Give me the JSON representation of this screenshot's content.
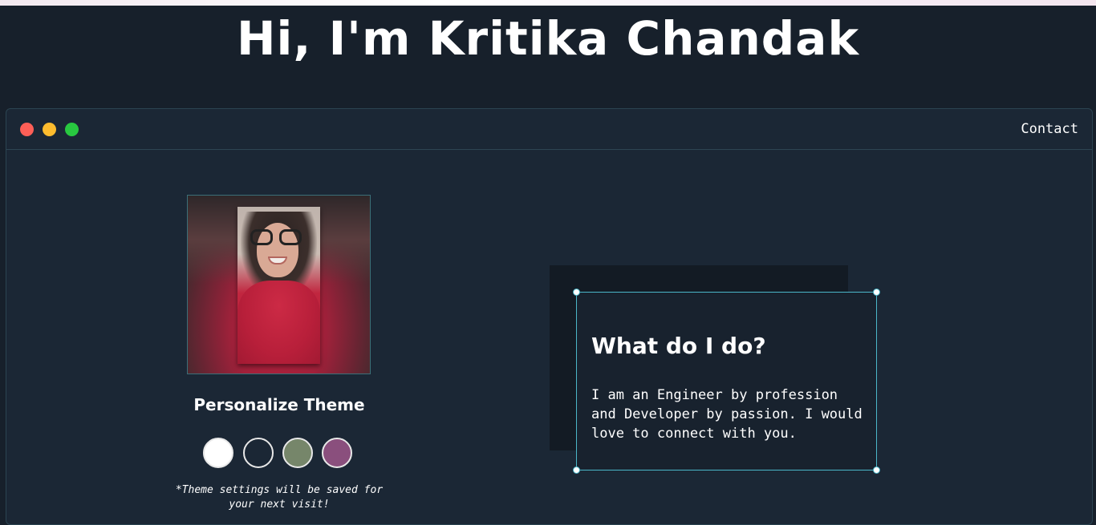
{
  "header": {
    "title": "Hi, I'm Kritika Chandak"
  },
  "window": {
    "controls": [
      "close",
      "minimize",
      "maximize"
    ],
    "nav": {
      "contact_label": "Contact"
    }
  },
  "profile": {
    "photo_icon": "profile-photo",
    "personalize_title": "Personalize Theme",
    "theme_swatches": [
      {
        "name": "white",
        "color": "#ffffff"
      },
      {
        "name": "dark",
        "color": "#1b2735"
      },
      {
        "name": "sage",
        "color": "#76866a"
      },
      {
        "name": "plum",
        "color": "#8a4f7d"
      }
    ],
    "theme_note": "*Theme settings will be saved for your next visit!"
  },
  "about": {
    "heading": "What do I do?",
    "body": "I am an Engineer by profession and Developer by passion. I would love to connect with you."
  },
  "colors": {
    "background": "#17202b",
    "window_bg": "#1b2735",
    "accent": "#4bb7c9",
    "close": "#fe5f57",
    "minimize": "#febc2e",
    "maximize": "#28c840"
  }
}
